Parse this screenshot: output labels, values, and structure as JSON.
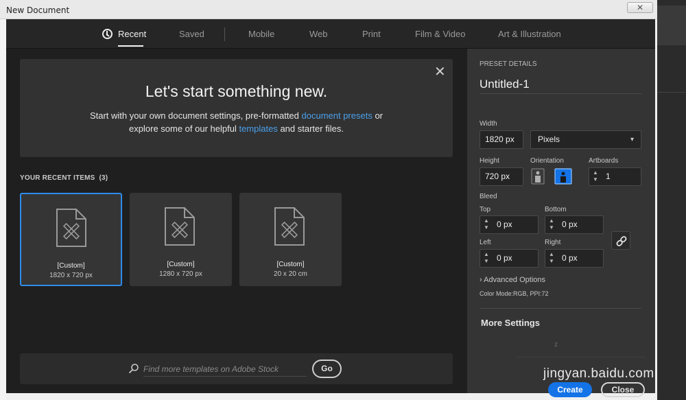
{
  "window": {
    "title": "New Document",
    "close_glyph": "✕"
  },
  "tabs": [
    {
      "label": "Recent",
      "icon": "clock-icon",
      "active": true
    },
    {
      "label": "Saved"
    },
    {
      "label": "Mobile"
    },
    {
      "label": "Web"
    },
    {
      "label": "Print"
    },
    {
      "label": "Film & Video"
    },
    {
      "label": "Art & Illustration"
    }
  ],
  "hero": {
    "title": "Let's start something new.",
    "line1_pre": "Start with your own document settings, pre-formatted ",
    "line1_link": "document presets",
    "line1_post": " or",
    "line2_pre": "explore some of our helpful ",
    "line2_link": "templates",
    "line2_post": " and starter files.",
    "close_glyph": "✕"
  },
  "recent": {
    "label": "YOUR RECENT ITEMS",
    "count": "(3)",
    "items": [
      {
        "title": "[Custom]",
        "size": "1820 x 720 px",
        "selected": true
      },
      {
        "title": "[Custom]",
        "size": "1280 x 720 px",
        "selected": false
      },
      {
        "title": "[Custom]",
        "size": "20 x 20 cm",
        "selected": false
      }
    ]
  },
  "search": {
    "placeholder": "Find more templates on Adobe Stock",
    "go_label": "Go"
  },
  "preset": {
    "heading": "PRESET DETAILS",
    "name": "Untitled-1",
    "width_label": "Width",
    "width_value": "1820 px",
    "units_value": "Pixels",
    "height_label": "Height",
    "height_value": "720 px",
    "orientation_label": "Orientation",
    "artboards_label": "Artboards",
    "artboards_value": "1",
    "bleed_label": "Bleed",
    "top_label": "Top",
    "top_value": "0 px",
    "bottom_label": "Bottom",
    "bottom_value": "0 px",
    "left_label": "Left",
    "left_value": "0 px",
    "right_label": "Right",
    "right_value": "0 px",
    "advanced_label": "Advanced Options",
    "color_mode": "Color Mode:RGB, PPI:72",
    "more_settings": "More Settings",
    "faint_char": "z",
    "create_label": "Create",
    "close_label": "Close"
  },
  "watermark": "jingyan.baidu.com",
  "colors": {
    "accent": "#2d8ceb",
    "link": "#4aa0ea",
    "create": "#1473e6"
  }
}
